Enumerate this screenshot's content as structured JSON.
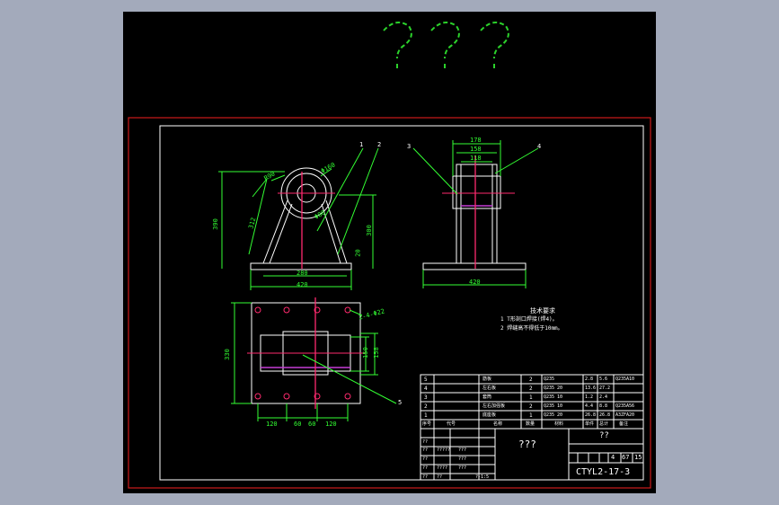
{
  "header": {
    "title": "???"
  },
  "colors": {
    "background": "#000000",
    "frame_outer": "#cc1b1b",
    "frame_inner": "#ffffff",
    "geometry": "#2bd12b",
    "centerline": "#ff2a6e",
    "hidden": "#c53dd6",
    "dimension": "#33ff33",
    "text": "#ffffff",
    "title_text": "#ffffff"
  },
  "front_view": {
    "dims": {
      "height_total": "390",
      "height_leg": "312",
      "radius_top": "R90",
      "bore": "Φ160",
      "bore_inner": "Φ80",
      "height_right": "300",
      "base_thk": "20",
      "width_inner": "280",
      "width_base": "420"
    },
    "leaders": [
      "1",
      "2"
    ]
  },
  "side_view": {
    "dims": {
      "w1": "178",
      "w2": "158",
      "w3": "118",
      "width_base": "420"
    },
    "leaders": [
      "3",
      "4"
    ]
  },
  "top_view": {
    "dims": {
      "depth": "330",
      "hole": "2-4-Φ22",
      "d150": "150",
      "d158": "158",
      "spacing": [
        "120",
        "60",
        "60",
        "120"
      ]
    },
    "leaders": [
      "5"
    ]
  },
  "notes": {
    "heading": "技术要求",
    "lines": [
      "1 T形剖口焊接(焊4)。",
      "2 焊缝高不得低于10mm。"
    ]
  },
  "bom": {
    "rows": [
      {
        "no": "5",
        "name": "筋板",
        "qty": "2",
        "mat": "Q235",
        "w1": "2.8",
        "w2": "5.6",
        "note": "Q235A10"
      },
      {
        "no": "4",
        "name": "左右板",
        "qty": "2",
        "mat": "Q235 20",
        "w1": "13.6",
        "w2": "27.2",
        "note": ""
      },
      {
        "no": "3",
        "name": "套筒",
        "qty": "1",
        "mat": "Q235 10",
        "w1": "1.2",
        "w2": "2.4",
        "note": ""
      },
      {
        "no": "2",
        "name": "左右加强板",
        "qty": "2",
        "mat": "Q235 10",
        "w1": "4.4",
        "w2": "8.8",
        "note": "Q235A56"
      },
      {
        "no": "1",
        "name": "底座板",
        "qty": "1",
        "mat": "Q235 20",
        "w1": "26.8",
        "w2": "26.8",
        "note": "A3ZFA20"
      }
    ],
    "header": [
      "序号",
      "代号",
      "名称",
      "数量",
      "材料",
      "单件",
      "总计",
      "备注"
    ]
  },
  "title_block": {
    "center": "???",
    "top_right": "??",
    "scale_cells": [
      "4",
      "67",
      "15"
    ],
    "drawing_no": "CTYL2-17-3",
    "left_cells": [
      "??",
      "?????",
      "???",
      "??",
      "???",
      "??",
      "??",
      "????",
      "??",
      "??",
      "???",
      "??",
      "??",
      "??",
      "??",
      "??",
      "??",
      "?-1:5"
    ]
  }
}
